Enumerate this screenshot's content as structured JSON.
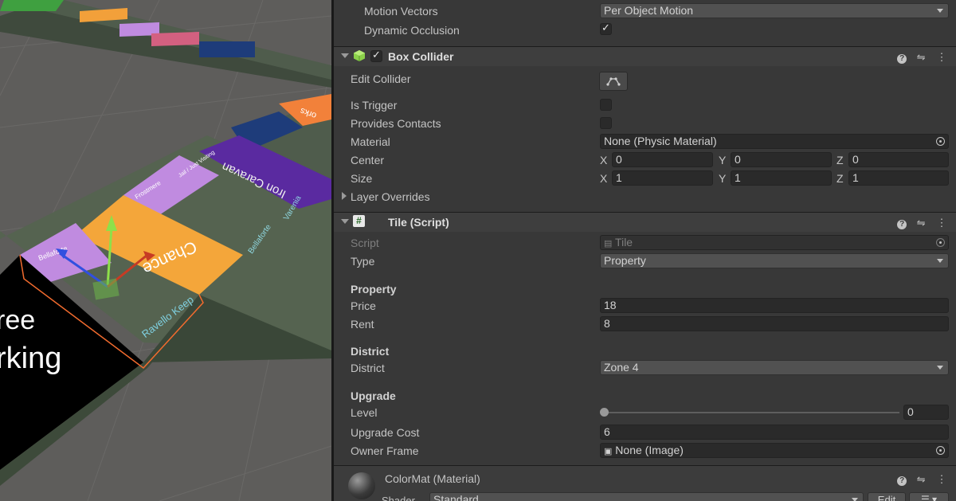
{
  "scene": {
    "free_parking_line1": "ree",
    "free_parking_line2": "rking",
    "chance_label": "Chance",
    "iron_caravan": "Iron Caravan",
    "bellaforte_1": "Bellaforte",
    "bellaforte_2": "Bellaforte",
    "ravello_keep": "Ravello Keep",
    "frostmere": "Frostmere",
    "jail_visiting": "Jail / Just Visiting",
    "varenia": "Varenia",
    "works": "orks"
  },
  "renderer": {
    "motion_vectors_label": "Motion Vectors",
    "motion_vectors_value": "Per Object Motion",
    "dynamic_occlusion_label": "Dynamic Occlusion",
    "dynamic_occlusion_checked": true
  },
  "box_collider": {
    "title": "Box Collider",
    "enabled": true,
    "edit_collider_label": "Edit Collider",
    "is_trigger_label": "Is Trigger",
    "is_trigger_checked": false,
    "provides_contacts_label": "Provides Contacts",
    "provides_contacts_checked": false,
    "material_label": "Material",
    "material_value": "None (Physic Material)",
    "center_label": "Center",
    "center": {
      "x": "0",
      "y": "0",
      "z": "0"
    },
    "size_label": "Size",
    "size": {
      "x": "1",
      "y": "1",
      "z": "1"
    },
    "layer_overrides_label": "Layer Overrides",
    "axis_x": "X",
    "axis_y": "Y",
    "axis_z": "Z"
  },
  "tile_script": {
    "title": "Tile (Script)",
    "script_label": "Script",
    "script_value": "Tile",
    "type_label": "Type",
    "type_value": "Property",
    "property_header": "Property",
    "price_label": "Price",
    "price_value": "18",
    "rent_label": "Rent",
    "rent_value": "8",
    "district_header": "District",
    "district_label": "District",
    "district_value": "Zone 4",
    "upgrade_header": "Upgrade",
    "level_label": "Level",
    "level_value": "0",
    "upgrade_cost_label": "Upgrade Cost",
    "upgrade_cost_value": "6",
    "owner_frame_label": "Owner Frame",
    "owner_frame_value": "None (Image)"
  },
  "material": {
    "title": "ColorMat (Material)",
    "shader_label": "Shader",
    "shader_value": "Standard",
    "edit_label": "Edit"
  },
  "colors": {
    "inspector_bg": "#383838",
    "chance_orange": "#f4a63a",
    "purple": "#6a2fa0",
    "lavender": "#c08be0",
    "tile_orange": "#f2813a"
  }
}
